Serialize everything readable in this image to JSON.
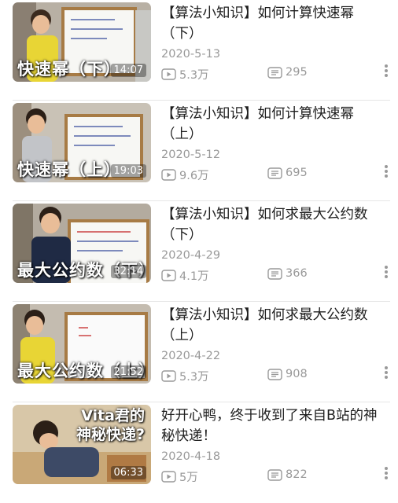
{
  "videos": [
    {
      "title": "【算法小知识】如何计算快速幂（下）",
      "date": "2020-5-13",
      "views": "5.3万",
      "comments": "295",
      "overlay": "快速幂（下）",
      "duration": "14:07"
    },
    {
      "title": "【算法小知识】如何计算快速幂（上）",
      "date": "2020-5-12",
      "views": "9.6万",
      "comments": "695",
      "overlay": "快速幂（上）",
      "duration": "19:03"
    },
    {
      "title": "【算法小知识】如何求最大公约数（下）",
      "date": "2020-4-29",
      "views": "4.1万",
      "comments": "366",
      "overlay": "最大公约数（下）",
      "duration": "32:14"
    },
    {
      "title": "【算法小知识】如何求最大公约数（上）",
      "date": "2020-4-22",
      "views": "5.3万",
      "comments": "908",
      "overlay": "最大公约数（上）",
      "duration": "21:52"
    },
    {
      "title": "好开心鸭，终于收到了来自B站的神秘快递！",
      "date": "2020-4-18",
      "views": "5万",
      "comments": "822",
      "overlay_line1": "Vita君的",
      "overlay_line2": "神秘快递?",
      "duration": "06:33"
    }
  ],
  "icons": {
    "views": "play-count-icon",
    "comments": "danmaku-count-icon",
    "more": "more-vertical-icon"
  },
  "colors": {
    "meta_text": "#999999",
    "title_text": "#1e1e1e",
    "separator": "#e6e6e6"
  }
}
